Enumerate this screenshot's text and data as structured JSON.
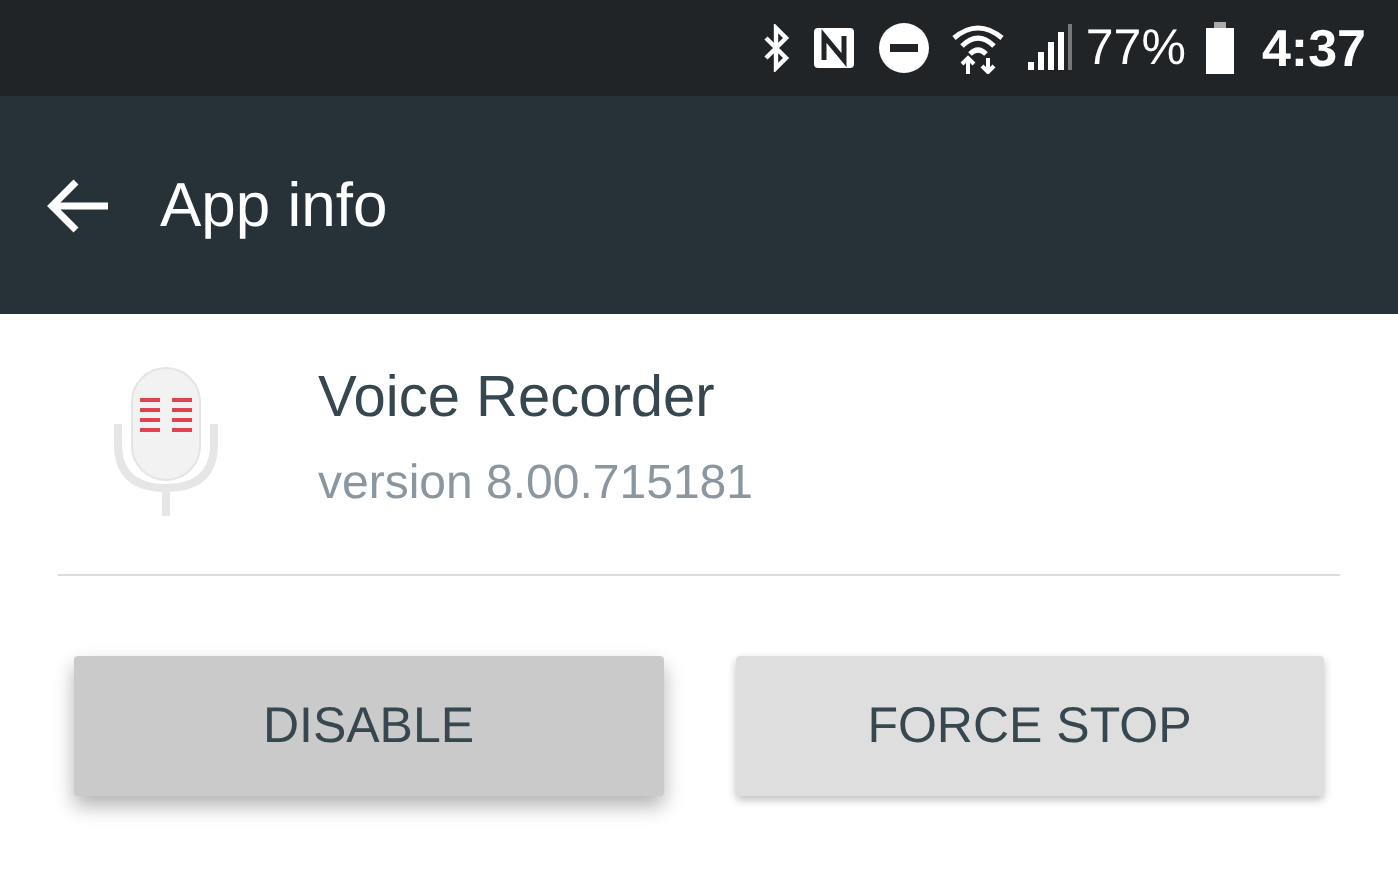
{
  "status_bar": {
    "battery": "77%",
    "time": "4:37"
  },
  "toolbar": {
    "title": "App info"
  },
  "app": {
    "name": "Voice Recorder",
    "version": "version 8.00.715181"
  },
  "buttons": [
    {
      "label": "DISABLE",
      "pressed": true
    },
    {
      "label": "FORCE STOP",
      "pressed": false
    }
  ]
}
